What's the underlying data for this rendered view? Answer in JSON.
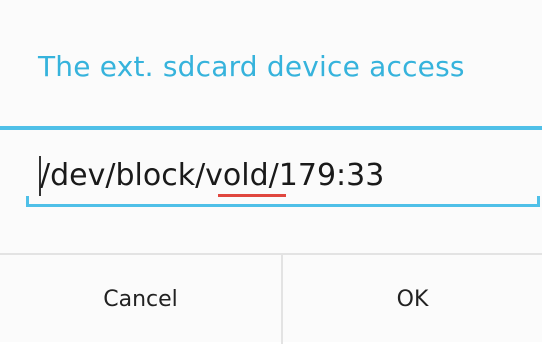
{
  "dialog": {
    "title": "The ext. sdcard device access",
    "input": {
      "value": "/dev/block/vold/179:33",
      "misspelled_word": "vold"
    },
    "buttons": {
      "cancel_label": "Cancel",
      "ok_label": "OK"
    }
  },
  "colors": {
    "accent": "#36b3dc",
    "spellcheck": "#e0473f"
  }
}
